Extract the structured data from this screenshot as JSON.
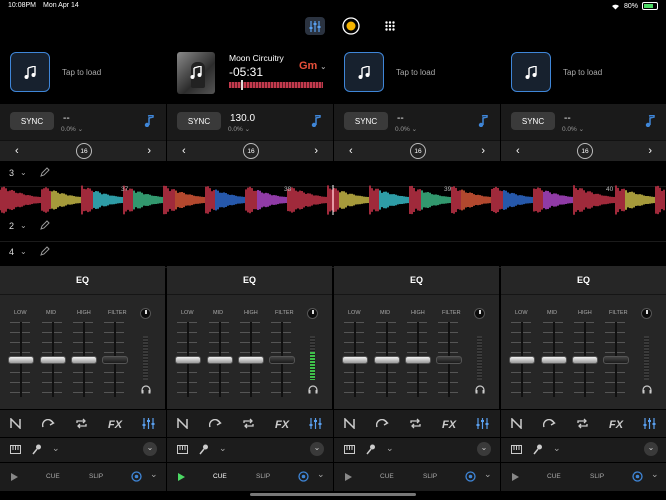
{
  "status_bar": {
    "time": "10:08PM",
    "date": "Mon Apr 14",
    "battery": "80%"
  },
  "colors": {
    "accent": "#3f86d8",
    "key": "#e8503a",
    "play_active": "#4cd964",
    "meter_green": "#3fbf4a"
  },
  "top_nav": {
    "icons": [
      "mixer-sliders-icon",
      "record-icon",
      "grid-icon"
    ]
  },
  "decks": [
    {
      "empty": true,
      "load_text": "Tap to load",
      "sync_label": "SYNC",
      "bpm": "--",
      "pitch": "0.0%",
      "loop_size": "16"
    },
    {
      "empty": false,
      "title": "Moon Circuitry",
      "time": "-05:31",
      "key": "Gm",
      "sync_label": "SYNC",
      "bpm": "130.0",
      "pitch": "0.0%",
      "loop_size": "16"
    },
    {
      "empty": true,
      "load_text": "Tap to load",
      "sync_label": "SYNC",
      "bpm": "--",
      "pitch": "0.0%",
      "loop_size": "16"
    },
    {
      "empty": true,
      "load_text": "Tap to load",
      "sync_label": "SYNC",
      "bpm": "--",
      "pitch": "0.0%",
      "loop_size": "16"
    }
  ],
  "deck_rows": [
    {
      "number": "3"
    },
    {
      "number": "2"
    },
    {
      "number": "4"
    }
  ],
  "waveform": {
    "beat_markers": [
      "37",
      "38",
      "39",
      "40"
    ]
  },
  "eq": {
    "title": "EQ",
    "band_labels": [
      "LOW",
      "MID",
      "HIGH",
      "FILTER"
    ]
  },
  "transport": {
    "cue_label": "CUE",
    "slip_label": "SLIP"
  },
  "toolbar_icons": [
    "n-icon",
    "redo-icon",
    "loop-icon",
    "fx-icon",
    "eq-sliders-icon"
  ]
}
